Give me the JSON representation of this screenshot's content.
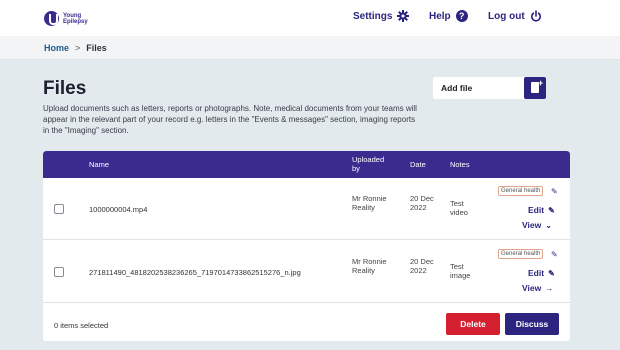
{
  "header": {
    "logo_text": "Young Epilepsy",
    "settings_label": "Settings",
    "help_label": "Help",
    "help_icon_glyph": "?",
    "logout_label": "Log out"
  },
  "breadcrumb": {
    "home": "Home",
    "separator": ">",
    "current": "Files"
  },
  "page": {
    "title": "Files",
    "intro": "Upload documents such as letters, reports or photographs. Note, medical documents from your teams will appear in the relevant part of your record e.g. letters in the \"Events & messages\" section, imaging reports in the \"Imaging\" section.",
    "add_file_label": "Add file"
  },
  "table": {
    "headers": {
      "name": "Name",
      "uploaded_by": "Uploaded by",
      "date": "Date",
      "notes": "Notes"
    },
    "rows": [
      {
        "name": "1000000004.mp4",
        "uploaded_by": "Mr Ronnie Reality",
        "date": "20 Dec 2022",
        "notes": "Test video",
        "tag": "General health",
        "edit_label": "Edit",
        "view_label": "View"
      },
      {
        "name": "271811490_481820253823626​5_7197014733862515276_n.jpg",
        "uploaded_by": "Mr Ronnie Reality",
        "date": "20 Dec 2022",
        "notes": "Test image",
        "tag": "General health",
        "edit_label": "Edit",
        "view_label": "View"
      }
    ],
    "footer": {
      "selected_text": "0 items selected",
      "delete_label": "Delete",
      "discuss_label": "Discuss"
    }
  },
  "colors": {
    "brand": "#2c2580",
    "header_row": "#3b2b8f",
    "delete": "#d4202f",
    "background": "#e3eaee"
  }
}
